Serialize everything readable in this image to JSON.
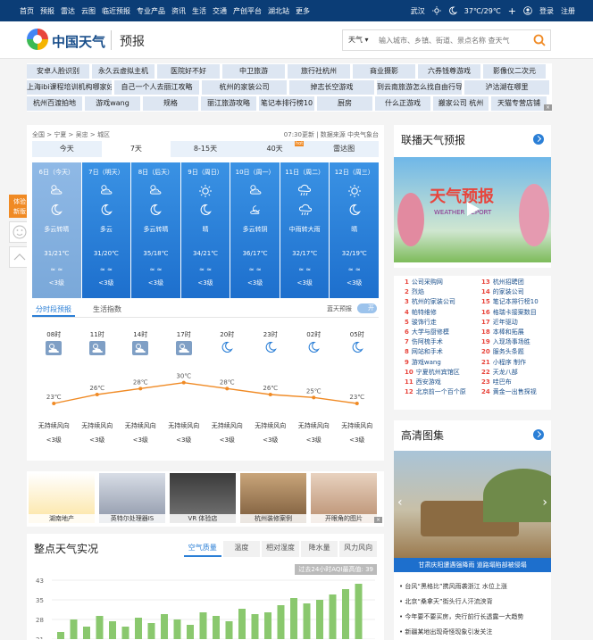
{
  "topbar": {
    "nav": [
      "首页",
      "预报",
      "雷达",
      "云图",
      "临近预报",
      "专业产品",
      "资讯",
      "生活",
      "交通",
      "产创平台",
      "湖北站",
      "更多"
    ],
    "city": "武汉",
    "temp": "37℃/29℃",
    "login": "登录",
    "register": "注册"
  },
  "header": {
    "brand": "中国天气",
    "sub": "预报",
    "search_scope": "天气",
    "search_placeholder": "输入城市、乡镇、街道、景点名称 查天气"
  },
  "ads": {
    "row1": [
      "安卓人脸识别",
      "永久云虚拟主机",
      "医院好不好",
      "中卫旅游",
      "旅行社杭州",
      "商业摄影",
      "六券钱尊游戏",
      "影像仪二次元"
    ],
    "row2": [
      "上海ibi课程培训机构哪家好",
      "自己一个人去丽江攻略",
      "杭州的家装公司",
      "掉志长空游戏",
      "到云南旅游怎么找自由行导游",
      "泸沽湖在哪里"
    ],
    "row3": [
      "杭州百渡拍地",
      "游戏wang",
      "规格",
      "丽江旅游攻略",
      "笔记本排行榜10",
      "厨房",
      "什么正游戏",
      "搬家公司 杭州",
      "天猫专营店铺"
    ]
  },
  "forecast": {
    "breadcrumb": "全国 > 宁夏 > 吴忠 > 城区",
    "updated": "07:30更新 | 数据来源 中央气象台",
    "tabs": [
      "今天",
      "7天",
      "8-15天",
      "40天",
      "雷达图"
    ],
    "days": [
      {
        "name": "6日（今天）",
        "weather": "多云转晴",
        "temp": "31/21℃",
        "wind": "≈ ≈",
        "level": "<3级",
        "icon": "partly-cloudy-icon",
        "icon2": "moon-icon"
      },
      {
        "name": "7日（明天）",
        "weather": "多云",
        "temp": "31/20℃",
        "wind": "≈ ≈",
        "level": "<3级",
        "icon": "partly-cloudy-icon",
        "icon2": "moon-icon"
      },
      {
        "name": "8日（后天）",
        "weather": "多云转晴",
        "temp": "35/18℃",
        "wind": "≈ ≈",
        "level": "<3级",
        "icon": "partly-cloudy-icon",
        "icon2": "moon-icon"
      },
      {
        "name": "9日（周日）",
        "weather": "晴",
        "temp": "34/21℃",
        "wind": "≈ ≈",
        "level": "<3级",
        "icon": "sun-icon",
        "icon2": "moon-icon"
      },
      {
        "name": "10日（周一）",
        "weather": "多云转阴",
        "temp": "36/17℃",
        "wind": "≈ ≈",
        "level": "<3级",
        "icon": "partly-cloudy-icon",
        "icon2": "cloudy-night-icon"
      },
      {
        "name": "11日（周二）",
        "weather": "中雨转大雨",
        "temp": "32/17℃",
        "wind": "≈ ≈",
        "level": "<3级",
        "icon": "rain-icon",
        "icon2": "rain-icon"
      },
      {
        "name": "12日（周三）",
        "weather": "晴",
        "temp": "32/19℃",
        "wind": "≈ ≈",
        "level": "<3级",
        "icon": "sun-icon",
        "icon2": "moon-icon"
      }
    ],
    "subtabs": [
      "分时段预报",
      "生活指数"
    ],
    "radar_label": "蓝天预报",
    "toggle": "开",
    "hours": [
      {
        "time": "08时",
        "temp": "23℃",
        "temp_value": 23,
        "wind": "无持续风向",
        "level": "<3级",
        "icon": "cloud-sun-icon"
      },
      {
        "time": "11时",
        "temp": "26℃",
        "temp_value": 26,
        "wind": "无持续风向",
        "level": "<3级",
        "icon": "cloud-sun-icon"
      },
      {
        "time": "14时",
        "temp": "28℃",
        "temp_value": 28,
        "wind": "无持续风向",
        "level": "<3级",
        "icon": "cloud-sun-icon"
      },
      {
        "time": "17时",
        "temp": "30℃",
        "temp_value": 30,
        "wind": "无持续风向",
        "level": "<3级",
        "icon": "cloud-sun-icon"
      },
      {
        "time": "20时",
        "temp": "28℃",
        "temp_value": 28,
        "wind": "无持续风向",
        "level": "<3级",
        "icon": "moon-icon"
      },
      {
        "time": "23时",
        "temp": "26℃",
        "temp_value": 26,
        "wind": "无持续风向",
        "level": "<3级",
        "icon": "moon-icon"
      },
      {
        "time": "02时",
        "temp": "25℃",
        "temp_value": 25,
        "wind": "无持续风向",
        "level": "<3级",
        "icon": "moon-icon"
      },
      {
        "time": "05时",
        "temp": "23℃",
        "temp_value": 23,
        "wind": "无持续风向",
        "level": "<3级",
        "icon": "moon-icon"
      }
    ]
  },
  "float": {
    "feedback": "体验\n新版"
  },
  "video": {
    "title": "联播天气预报",
    "banner": "天气预报",
    "banner_en": "WEATHER REPORT"
  },
  "rank": {
    "left": [
      "公司采购网",
      "烈焰",
      "杭州的家装公司",
      "帕特维修",
      "骏饰行走",
      "大学与厨修模",
      "伤阿梳手术",
      "网站和手术",
      "游戏wang",
      "宁夏杭州宾馆区",
      "西安游戏",
      "北京前一个百个原"
    ],
    "right": [
      "杭州招聘团",
      "的家装公司",
      "笔记本排行榜10",
      "格瑞卡接案数目",
      "近年驱动",
      "本棒和拓展",
      "入现场事场胜",
      "服务头条题",
      "小程序 制作",
      "天龙八部",
      "哇巴布",
      "黄金一出售探视"
    ]
  },
  "photos": [
    {
      "cap": "湖南地产",
      "icon": "poster-icon"
    },
    {
      "cap": "英特尔处理器IS",
      "icon": "cpu-icon"
    },
    {
      "cap": "VR 体验店",
      "icon": "vr-icon"
    },
    {
      "cap": "杭州装修案例",
      "icon": "interior-icon"
    },
    {
      "cap": "开眼角的图片",
      "icon": "eye-icon"
    }
  ],
  "aqi": {
    "title": "整点天气实况",
    "tabs": [
      "空气质量",
      "温度",
      "相对湿度",
      "降水量",
      "风力风向"
    ],
    "badge": "过去24小时AQI最高值: 39",
    "y_ticks": [
      "43",
      "35",
      "28",
      "21"
    ]
  },
  "gallery": {
    "title": "高清图集",
    "caption": "甘肃庆阳遭遇强降雨 道路塌陷部被侵塌",
    "news": [
      "台风“黑格比”携风雨袭浙江 水位上涨",
      "北京“桑拿天”街头行人汗流浃背",
      "今年要不要买房，央行前行长透露一大趋势",
      "新疆某地出现奇怪现象引发关注"
    ]
  },
  "chart_data": {
    "type": "line",
    "x": [
      "08时",
      "11时",
      "14时",
      "17时",
      "20时",
      "23时",
      "02时",
      "05时"
    ],
    "series": [
      {
        "values": [
          23,
          26,
          28,
          30,
          28,
          26,
          25,
          23
        ]
      }
    ]
  }
}
